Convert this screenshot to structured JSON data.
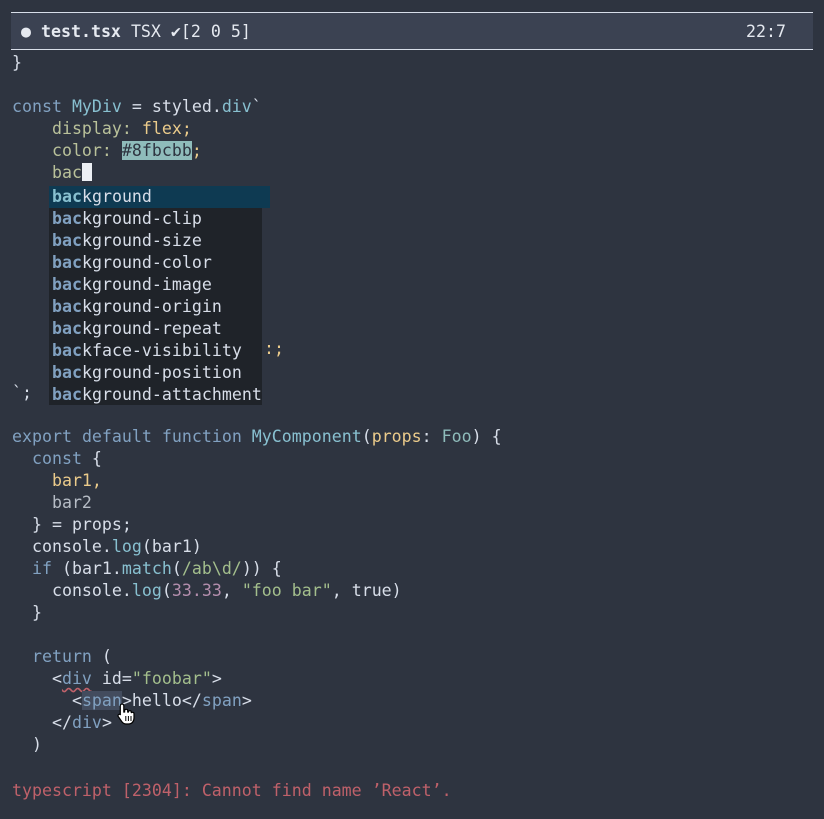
{
  "statusline": {
    "modified_dot": "●",
    "filename": "test.tsx",
    "filetype": "TSX",
    "diagnostics": "✔[2 0 5]",
    "position": "22:7"
  },
  "code": {
    "l1": "}",
    "l3_kw": "const",
    "l3_name": " MyDiv",
    "l3_eq": " = styled.",
    "l3_div": "div",
    "l3_tick": "`",
    "l4_prop": "    display:",
    "l4_val": " flex;",
    "l5_prop": "    color:",
    "l5_sp": " ",
    "l5_val": "#8fbcbb",
    "l5_semi": ";",
    "l6_text": "    bac",
    "l13_text": "`;",
    "l13_hidden": ":;",
    "l15_kw1": "export",
    "l15_kw2": " default",
    "l15_kw3": " function",
    "l15_fn": " MyComponent",
    "l15_open": "(",
    "l15_par": "props",
    "l15_colon": ": ",
    "l15_typ": "Foo",
    "l15_close": ") {",
    "l16_kw": "  const",
    "l16_rest": " {",
    "l17": "    bar1,",
    "l18": "    bar2",
    "l19": "  } = props;",
    "l20_obj": "  console.",
    "l20_fn": "log",
    "l20_rest": "(bar1)",
    "l21_kw": "  if",
    "l21_a": " (bar1.",
    "l21_fn": "match",
    "l21_b": "(",
    "l21_re": "/ab\\d/",
    "l21_c": ")) {",
    "l22_obj": "    console.",
    "l22_fn": "log",
    "l22_a": "(",
    "l22_num": "33.33",
    "l22_b": ", ",
    "l22_str": "\"foo bar\"",
    "l22_c": ", true)",
    "l23": "  }",
    "l25_kw": "  return",
    "l25_rest": " (",
    "l26_a": "    <",
    "l26_tag": "div",
    "l26_attr": " id=",
    "l26_str": "\"foobar\"",
    "l26_b": ">",
    "l27_a": "      <",
    "l27_tag": "span",
    "l27_b": ">hello</",
    "l27_tag2": "span",
    "l27_c": ">",
    "l28_a": "    </",
    "l28_tag": "div",
    "l28_b": ">",
    "l29": "  )"
  },
  "completion": {
    "typed": "bac",
    "items": [
      {
        "match": "bac",
        "rest": "kground",
        "selected": true
      },
      {
        "match": "bac",
        "rest": "kground-clip"
      },
      {
        "match": "bac",
        "rest": "kground-size"
      },
      {
        "match": "bac",
        "rest": "kground-color"
      },
      {
        "match": "bac",
        "rest": "kground-image"
      },
      {
        "match": "bac",
        "rest": "kground-origin"
      },
      {
        "match": "bac",
        "rest": "kground-repeat"
      },
      {
        "match": "bac",
        "rest": "kface-visibility"
      },
      {
        "match": "bac",
        "rest": "kground-position"
      },
      {
        "match": "bac",
        "rest": "kground-attachment"
      }
    ]
  },
  "error_message": "typescript [2304]: Cannot find name ’React’.",
  "colors": {
    "background": "#2e3440",
    "keyword": "#81a1c1",
    "error": "#bf616a",
    "selection": "#0e3a52"
  },
  "icons": {
    "mouse": "hand-pointer-icon"
  }
}
